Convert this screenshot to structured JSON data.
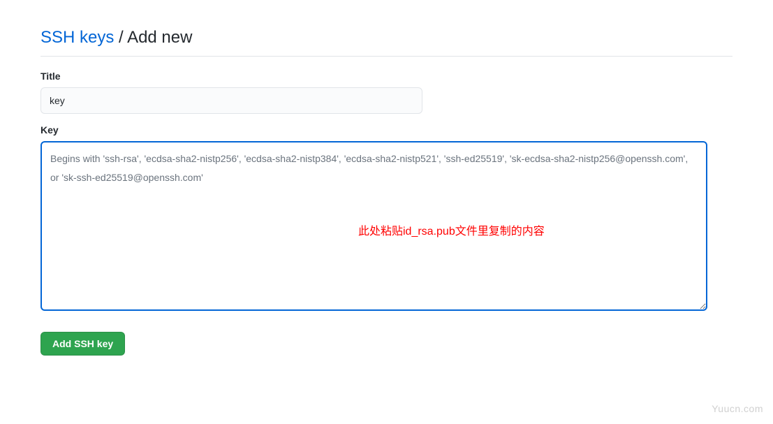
{
  "breadcrumb": {
    "link_text": "SSH keys",
    "separator": " / ",
    "current": "Add new"
  },
  "form": {
    "title": {
      "label": "Title",
      "value": "key"
    },
    "key": {
      "label": "Key",
      "placeholder": "Begins with 'ssh-rsa', 'ecdsa-sha2-nistp256', 'ecdsa-sha2-nistp384', 'ecdsa-sha2-nistp521', 'ssh-ed25519', 'sk-ecdsa-sha2-nistp256@openssh.com', or 'sk-ssh-ed25519@openssh.com'",
      "value": ""
    },
    "submit_label": "Add SSH key"
  },
  "annotation": "此处粘贴id_rsa.pub文件里复制的内容",
  "watermark": "Yuucn.com"
}
